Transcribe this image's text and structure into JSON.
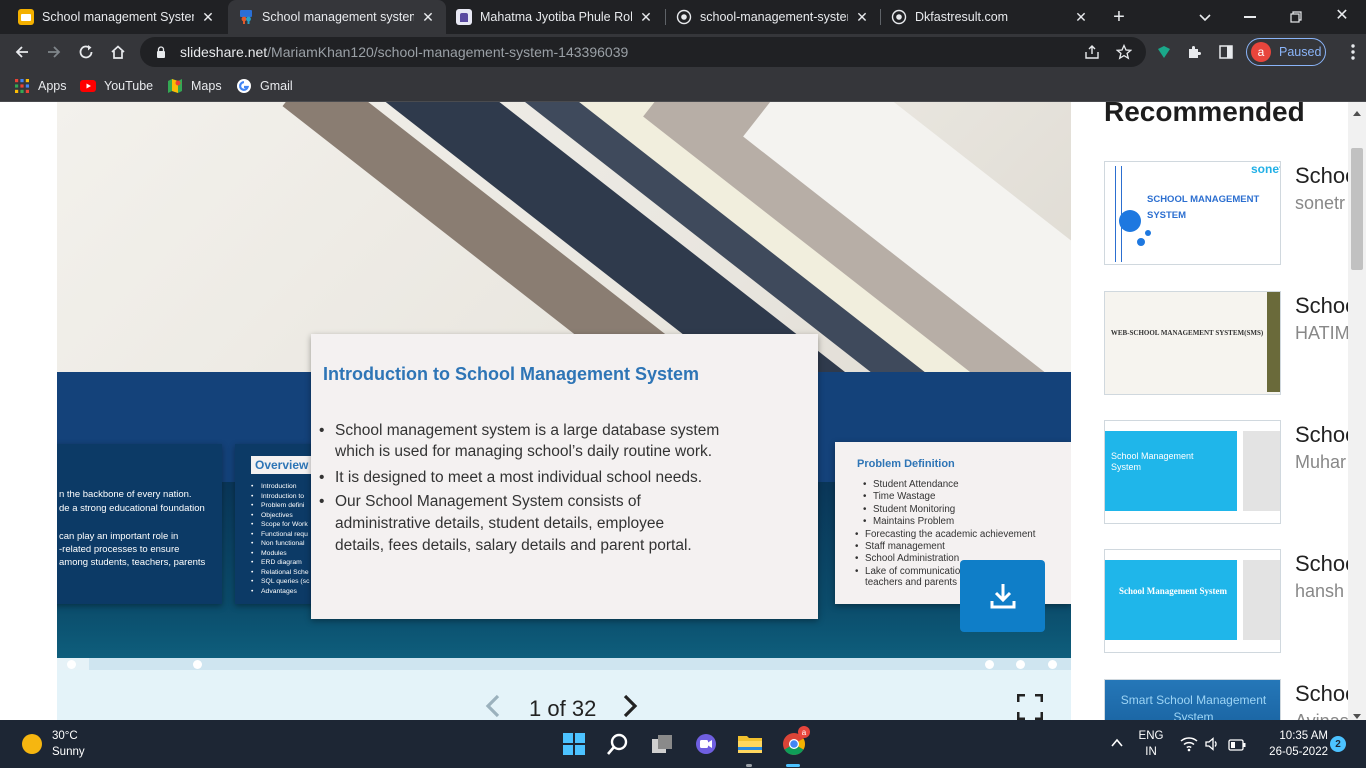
{
  "browser": {
    "tabs": [
      {
        "title": "School management System",
        "favicon": "slideshare-yellow-icon",
        "active": false
      },
      {
        "title": "School management system",
        "favicon": "slideshare-icon",
        "active": true
      },
      {
        "title": "Mahatma Jyotiba Phule Rohil",
        "favicon": "university-icon",
        "active": false
      },
      {
        "title": "school-management-system",
        "favicon": "globe-icon",
        "active": false
      },
      {
        "title": "Dkfastresult.com",
        "favicon": "globe-icon",
        "active": false
      }
    ],
    "url_host": "slideshare.net",
    "url_path": "/MariamKhan120/school-management-system-143396039",
    "profile_initial": "a",
    "profile_status": "Paused",
    "bookmarks": [
      {
        "label": "Apps"
      },
      {
        "label": "YouTube"
      },
      {
        "label": "Maps"
      },
      {
        "label": "Gmail"
      }
    ]
  },
  "slideshow": {
    "main_slide": {
      "title": "Introduction to School Management System",
      "bullets": [
        "School management system is a large database system",
        "which is used for managing school’s daily routine work.",
        "It is designed to meet a most individual school needs.",
        "Our School Management System consists of",
        "administrative details, student details, employee",
        "details, fees details, salary details and parent portal."
      ]
    },
    "left_slide": {
      "lines": [
        "n the backbone of every nation.",
        "de a strong educational foundation",
        "",
        "can play an important role in",
        "-related processes to ensure",
        "among students, teachers, parents"
      ]
    },
    "overview_slide": {
      "title": "Overview",
      "items": [
        "Introduction",
        "Introduction to",
        "Problem defini",
        "Objectives",
        "Scope for Work",
        "Functional requ",
        "Non functional",
        "Modules",
        "ERD diagram",
        "Relational Sche",
        "SQL queries (sc",
        "Advantages"
      ]
    },
    "problem_slide": {
      "title": "Problem Definition",
      "items": [
        {
          "text": "Student Attendance",
          "sub": true
        },
        {
          "text": "Time Wastage",
          "sub": true
        },
        {
          "text": "Student Monitoring",
          "sub": true
        },
        {
          "text": "Maintains Problem",
          "sub": true
        },
        {
          "text": "Forecasting the academic achievement",
          "sub": false
        },
        {
          "text": "Staff management",
          "sub": false
        },
        {
          "text": "School Administration",
          "sub": false
        },
        {
          "text": "Lake of communicatio",
          "sub": false
        },
        {
          "text": "teachers and parents",
          "sub": false,
          "continuation": true
        }
      ]
    },
    "pager": {
      "current": "1",
      "of_label": "of",
      "total": "32"
    }
  },
  "recommended": {
    "title": "Recommended",
    "items": [
      {
        "name": "School",
        "author": "sonetr",
        "thumb_text": "SCHOOL MANAGEMENT SYSTEM",
        "thumb_brand": "sonet"
      },
      {
        "name": "School",
        "author": "HATIM",
        "thumb_text": "WEB-SCHOOL MANAGEMENT SYSTEM(SMS)"
      },
      {
        "name": "School",
        "author": "Muhar",
        "thumb_text": "School Management System"
      },
      {
        "name": "School",
        "author": "hansh",
        "thumb_text": "School Management System"
      },
      {
        "name": "School",
        "author": "Avinas",
        "thumb_text": "Smart School Management System"
      }
    ]
  },
  "taskbar": {
    "temperature": "30°C",
    "condition": "Sunny",
    "lang_line1": "ENG",
    "lang_line2": "IN",
    "time": "10:35 AM",
    "date": "26-05-2022",
    "notification_count": "2",
    "chrome_badge": "a"
  },
  "colors": {
    "accent_blue": "#2e75b6",
    "download_blue": "#0f7ec8",
    "taskbar": "#1d2634"
  }
}
